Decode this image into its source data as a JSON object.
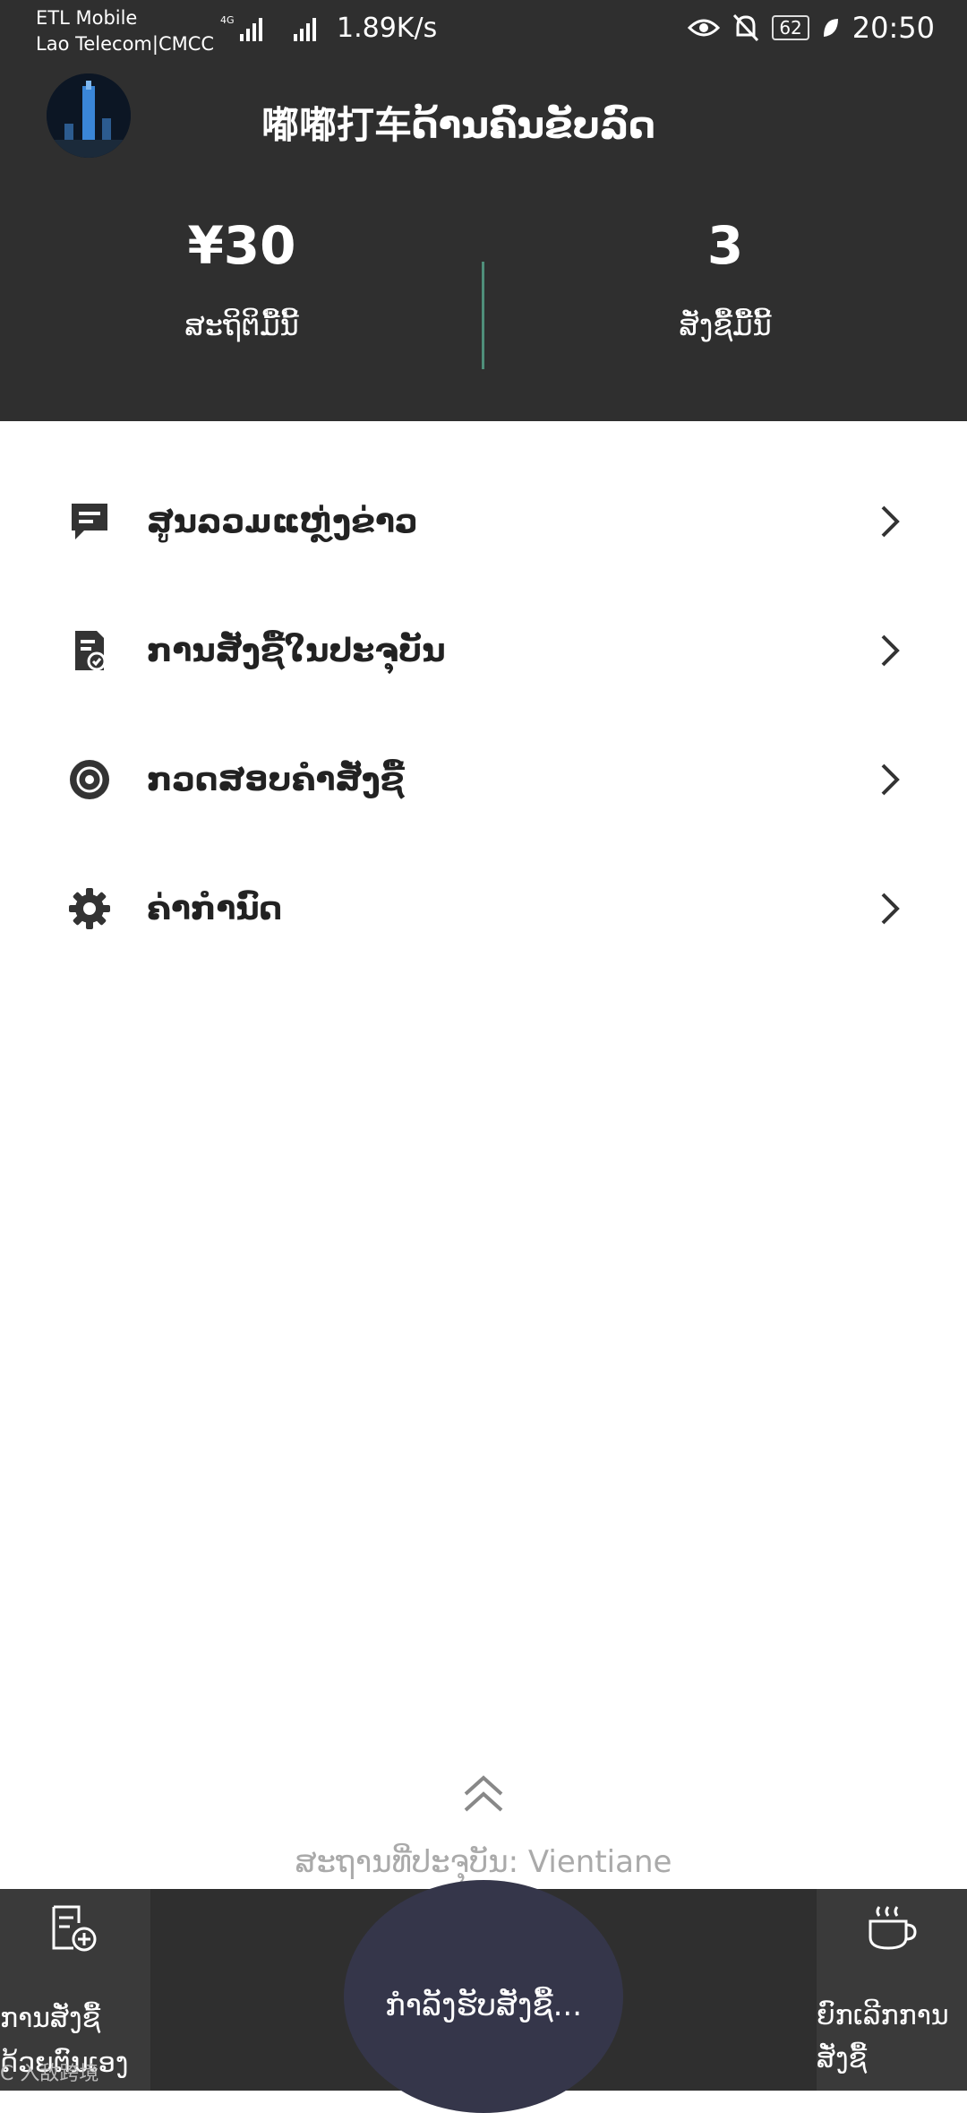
{
  "status_bar": {
    "carrier_1": "ETL Mobile",
    "carrier_2": "Lao Telecom|CMCC",
    "net_speed": "1.89K/s",
    "battery": "62",
    "time": "20:50"
  },
  "header": {
    "title": "嘟嘟打车ດ້ານຄົນຂັບລົດ",
    "earnings_value": "¥30",
    "earnings_label": "ສະຖິຕິມື້ນີ້",
    "orders_value": "3",
    "orders_label": "ສັ່ງຊື້ມື້ນີ້"
  },
  "menu": [
    {
      "label": "ສູນລວມແຫຼ່ງຂ່າວ",
      "icon": "message-icon"
    },
    {
      "label": "ການສັ່ງຊື້ໃນປະຈຸບັນ",
      "icon": "order-document-icon"
    },
    {
      "label": "ກວດສອບຄຳສັ່ງຊື້",
      "icon": "target-icon"
    },
    {
      "label": "ຄ່າກຳນົດ",
      "icon": "gear-icon"
    }
  ],
  "location_text": "ສະຖານທີ່ປະຈຸບັນ: Vientiane",
  "bottom_bar": {
    "left_label": "ການສັ່ງຊື້ດ້ວຍຕົນເອງ",
    "center_label": "ກຳລັງຮັບສັ່ງຊື້...",
    "right_label": "ຍົກເລີກການສັ່ງຊື້"
  },
  "watermark": "C 入敌跨境",
  "colors": {
    "header_bg": "#2f2f2f",
    "divider": "#4f8f7a",
    "text_dark": "#222222",
    "location_text": "#aaaaaa"
  }
}
